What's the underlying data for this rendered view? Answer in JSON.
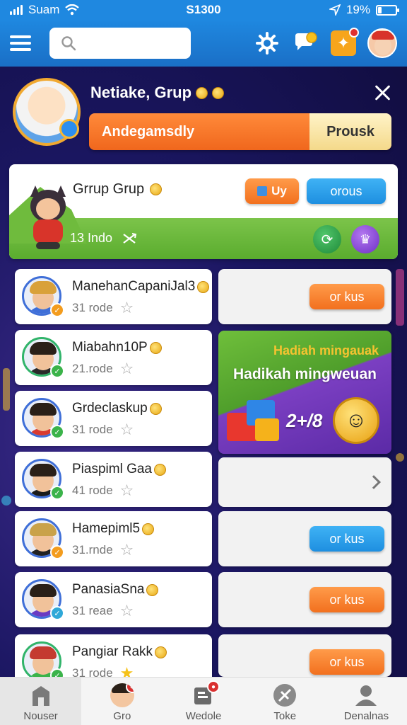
{
  "status_bar": {
    "carrier": "Suam",
    "time": "S1300",
    "battery": "19%",
    "battery_level": 0.19
  },
  "app_bar": {
    "search_placeholder": "",
    "icons": [
      "menu-icon",
      "search-icon",
      "gear-icon",
      "chat-icon",
      "gift-icon",
      "avatar"
    ]
  },
  "profile": {
    "name": "Netiake, Grup",
    "bar_label": "Andegamsdly",
    "bar_button": "Prousk"
  },
  "group": {
    "title": "Grrup Grup",
    "members": "13 Indo",
    "btn_left": "Uy",
    "btn_right": "orous"
  },
  "rows": [
    {
      "name": "ManehanCapaniJal3",
      "sub": "31 rode",
      "star": "gray",
      "badge_color": "#f39c1e",
      "ring": "#3f6fd8",
      "hair": "#d9a13a",
      "shirt": "#3f6fd8"
    },
    {
      "name": "Miabahn10P",
      "sub": "21.rode",
      "star": "gray",
      "badge_color": "#3bb34a",
      "ring": "#31b46a",
      "hair": "#2a2018",
      "shirt": "#2a2a2a"
    },
    {
      "name": "Grdeclaskup",
      "sub": "31 rode",
      "star": "gray",
      "badge_color": "#3bb34a",
      "ring": "#3f6fd8",
      "hair": "#2a2018",
      "shirt": "#d83a30"
    },
    {
      "name": "Piaspiml Gaa",
      "sub": "41 rode",
      "star": "gray",
      "badge_color": "#3bb34a",
      "ring": "#3f6fd8",
      "hair": "#2a2018",
      "shirt": "#1b1b1b"
    },
    {
      "name": "Hamepiml5",
      "sub": "31.rnde",
      "star": "gray",
      "badge_color": "#f39c1e",
      "ring": "#3f6fd8",
      "hair": "#c9a24a",
      "shirt": "#222"
    },
    {
      "name": "PanasiaSna",
      "sub": "31 reae",
      "star": "gray",
      "badge_color": "#2fa8d8",
      "ring": "#3f6fd8",
      "hair": "#2a2018",
      "shirt": "#6a3ac2"
    },
    {
      "name": "Pangiar Rakk",
      "sub": "31 rode",
      "star": "gold",
      "badge_color": "#3bb34a",
      "ring": "#31b46a",
      "hair": "#c43a30",
      "shirt": "#3bb34a"
    }
  ],
  "panels": [
    {
      "type": "button",
      "label": "or kus",
      "color": "orange"
    },
    {
      "type": "promo"
    },
    {
      "type": "chevron"
    },
    {
      "type": "button",
      "label": "or kus",
      "color": "blue"
    },
    {
      "type": "button",
      "label": "or kus",
      "color": "orange"
    },
    {
      "type": "button",
      "label": "or kus",
      "color": "orange"
    }
  ],
  "promo": {
    "title_small": "Hadiah mingauak",
    "title_big": "Hadikah mingweuan",
    "amount": "2+/8"
  },
  "bottom_nav": [
    {
      "label": "Nouser",
      "icon": "home-icon"
    },
    {
      "label": "Gro",
      "icon": "avatar"
    },
    {
      "label": "Wedole",
      "icon": "document-icon"
    },
    {
      "label": "Toke",
      "icon": "leaf-icon"
    },
    {
      "label": "Denalnas",
      "icon": "profile-icon"
    }
  ]
}
